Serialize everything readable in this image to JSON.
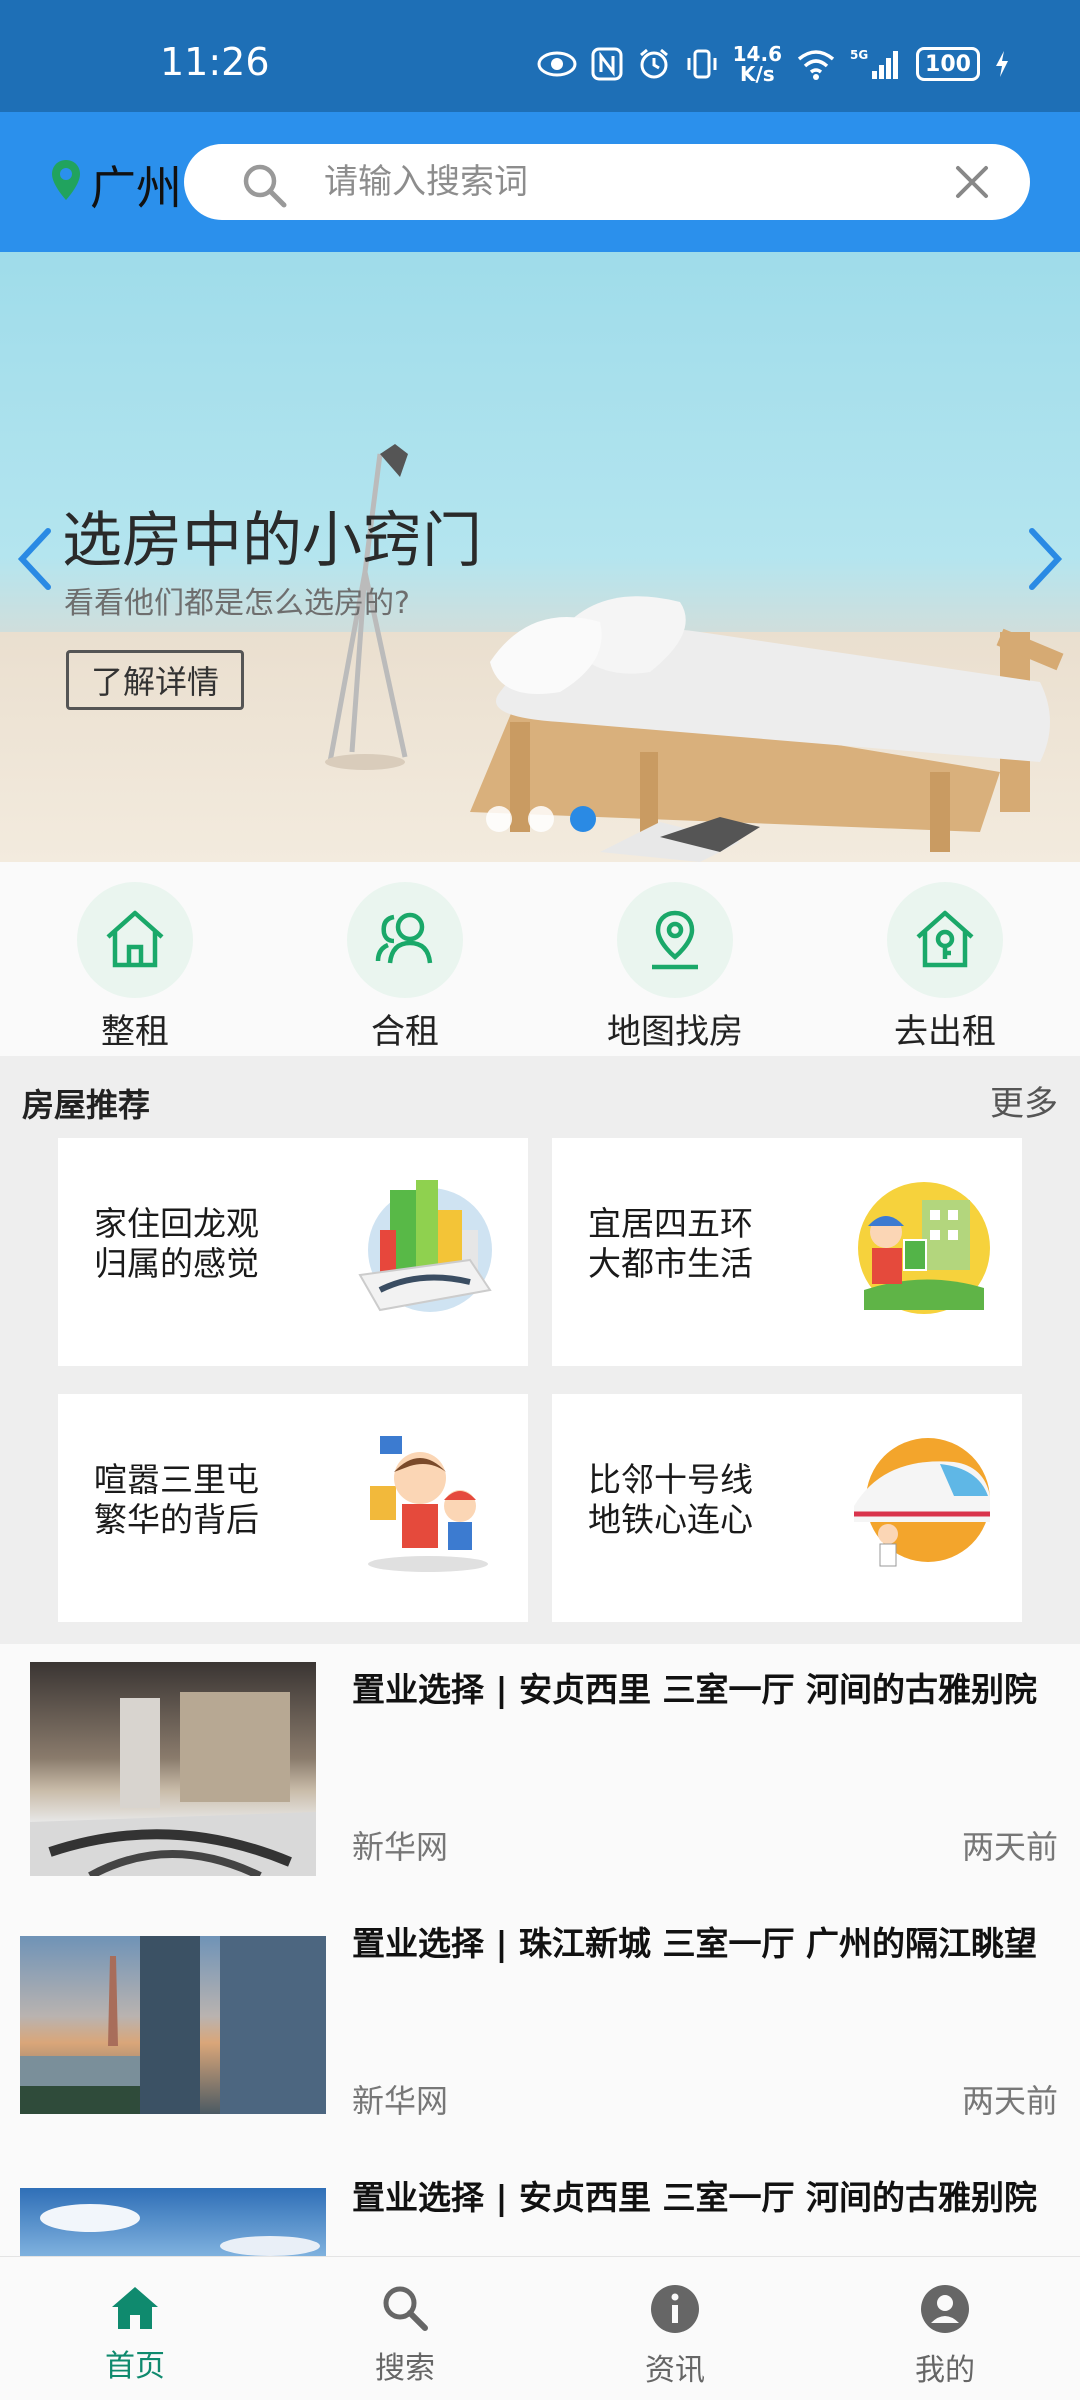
{
  "status_bar": {
    "time": "11:26",
    "net_speed_value": "14.6",
    "net_speed_unit": "K/s",
    "battery": "100",
    "icons": [
      "eye-icon",
      "nfc-icon",
      "alarm-icon",
      "vibrate-icon",
      "wifi-icon",
      "5g-signal-icon",
      "battery-icon",
      "charging-icon"
    ]
  },
  "header": {
    "city": "广州",
    "search_placeholder": "请输入搜索词",
    "colors": {
      "bar": "#2b90ec",
      "location_pin": "#21a35e"
    }
  },
  "banner": {
    "title": "选房中的小窍门",
    "subtitle": "看看他们都是怎么选房的?",
    "button_label": "了解详情",
    "slide_count": 3,
    "active_slide": 3
  },
  "quick_nav": {
    "accent_color": "#1aa869",
    "items": [
      {
        "label": "整租",
        "icon": "house-icon"
      },
      {
        "label": "合租",
        "icon": "people-icon"
      },
      {
        "label": "地图找房",
        "icon": "map-pin-icon"
      },
      {
        "label": "去出租",
        "icon": "house-key-icon"
      }
    ]
  },
  "recommend": {
    "title": "房屋推荐",
    "more_label": "更多",
    "cards": [
      {
        "line1": "家住回龙观",
        "line2": "归属的感觉",
        "icon": "city-buildings-illustration"
      },
      {
        "line1": "宜居四五环",
        "line2": "大都市生活",
        "icon": "rent-sign-illustration"
      },
      {
        "line1": "喧嚣三里屯",
        "line2": "繁华的背后",
        "icon": "family-illustration"
      },
      {
        "line1": "比邻十号线",
        "line2": "地铁心连心",
        "icon": "subway-train-illustration"
      }
    ]
  },
  "news": [
    {
      "title": "置业选择 | 安贞西里 三室一厅 河间的古雅别院",
      "source": "新华网",
      "time": "两天前"
    },
    {
      "title": "置业选择 | 珠江新城 三室一厅 广州的隔江眺望",
      "source": "新华网",
      "time": "两天前"
    },
    {
      "title": "置业选择 | 安贞西里 三室一厅 河间的古雅别院",
      "source": "",
      "time": ""
    }
  ],
  "tabbar": {
    "active_color": "#0f8a6e",
    "tabs": [
      {
        "label": "首页",
        "icon": "home-icon"
      },
      {
        "label": "搜索",
        "icon": "search-icon"
      },
      {
        "label": "资讯",
        "icon": "info-icon"
      },
      {
        "label": "我的",
        "icon": "profile-icon"
      }
    ]
  }
}
